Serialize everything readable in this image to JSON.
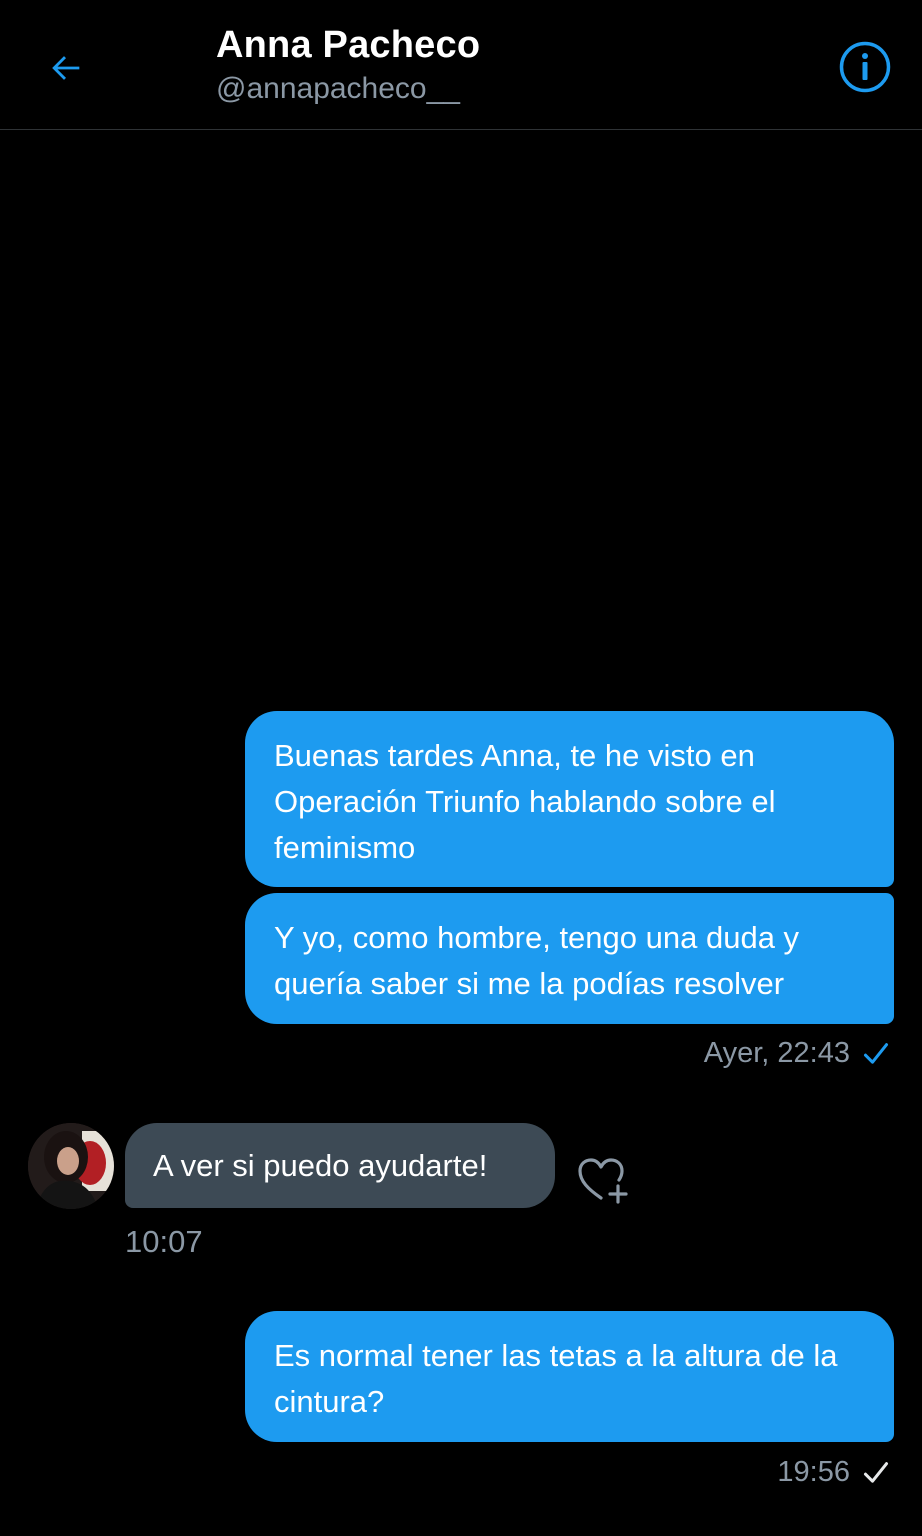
{
  "header": {
    "name": "Anna Pacheco",
    "handle": "@annapacheco__"
  },
  "messages": [
    {
      "direction": "outgoing",
      "text": "Buenas tardes Anna, te he visto en Operación Triunfo hablando sobre el feminismo"
    },
    {
      "direction": "outgoing",
      "text": "Y yo, como hombre, tengo una duda y quería saber si me la podías resolver",
      "timestamp": "Ayer, 22:43",
      "status_icon": "check-icon",
      "status_color": "#1d9bf0"
    },
    {
      "direction": "incoming",
      "text": "A ver si puedo ayudarte!",
      "timestamp": "10:07",
      "reaction_icon": "heart-plus-icon"
    },
    {
      "direction": "outgoing",
      "text": "Es normal tener las tetas a la altura de la cintura?",
      "timestamp": "19:56",
      "status_icon": "check-icon",
      "status_color": "#e7e9ea"
    }
  ],
  "colors": {
    "accent": "#1d9bf0",
    "background": "#000000",
    "incoming_bubble": "#3d4a55",
    "muted_text": "#8b98a5"
  }
}
